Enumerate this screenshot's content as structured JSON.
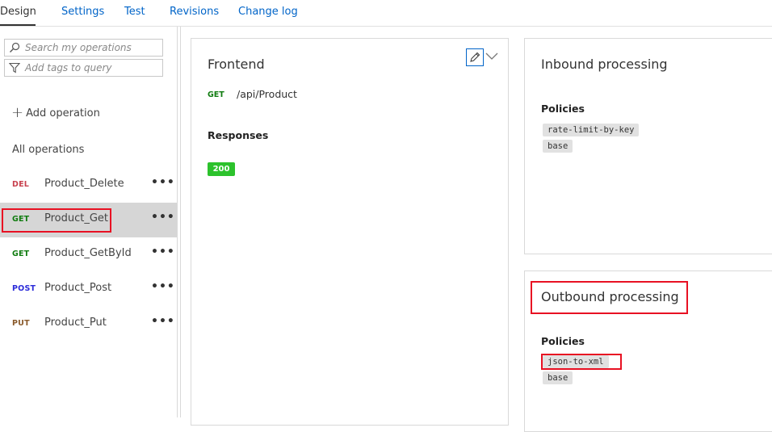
{
  "tabs": {
    "design": "Design",
    "settings": "Settings",
    "test": "Test",
    "revisions": "Revisions",
    "changelog": "Change log"
  },
  "sidebar": {
    "search_placeholder": "Search my operations",
    "tags_placeholder": "Add tags to query",
    "add_operation": "Add operation",
    "all_operations": "All operations",
    "operations": [
      {
        "method": "DEL",
        "name": "Product_Delete",
        "method_color": "#c8414e",
        "selected": false
      },
      {
        "method": "GET",
        "name": "Product_Get",
        "method_color": "#107c10",
        "selected": true
      },
      {
        "method": "GET",
        "name": "Product_GetById",
        "method_color": "#107c10",
        "selected": false
      },
      {
        "method": "POST",
        "name": "Product_Post",
        "method_color": "#2b2bd9",
        "selected": false
      },
      {
        "method": "PUT",
        "name": "Product_Put",
        "method_color": "#8a5a2b",
        "selected": false
      }
    ],
    "more_glyph": "•••"
  },
  "frontend": {
    "title": "Frontend",
    "method": "GET",
    "path": "/api/Product",
    "responses_label": "Responses",
    "response_code": "200"
  },
  "inbound": {
    "title": "Inbound processing",
    "policies_label": "Policies",
    "policies": [
      "rate-limit-by-key",
      "base"
    ]
  },
  "outbound": {
    "title": "Outbound processing",
    "policies_label": "Policies",
    "policies": [
      "json-to-xml",
      "base"
    ]
  },
  "icons": {
    "search": "search-icon",
    "filter": "filter-icon",
    "edit": "pencil-icon",
    "expand": "chevron-down-icon",
    "add": "plus-icon"
  },
  "colors": {
    "accent": "#0064c8",
    "highlight": "#e81123",
    "response_ok": "#2cc22c",
    "selected_row": "#d6d6d6"
  }
}
